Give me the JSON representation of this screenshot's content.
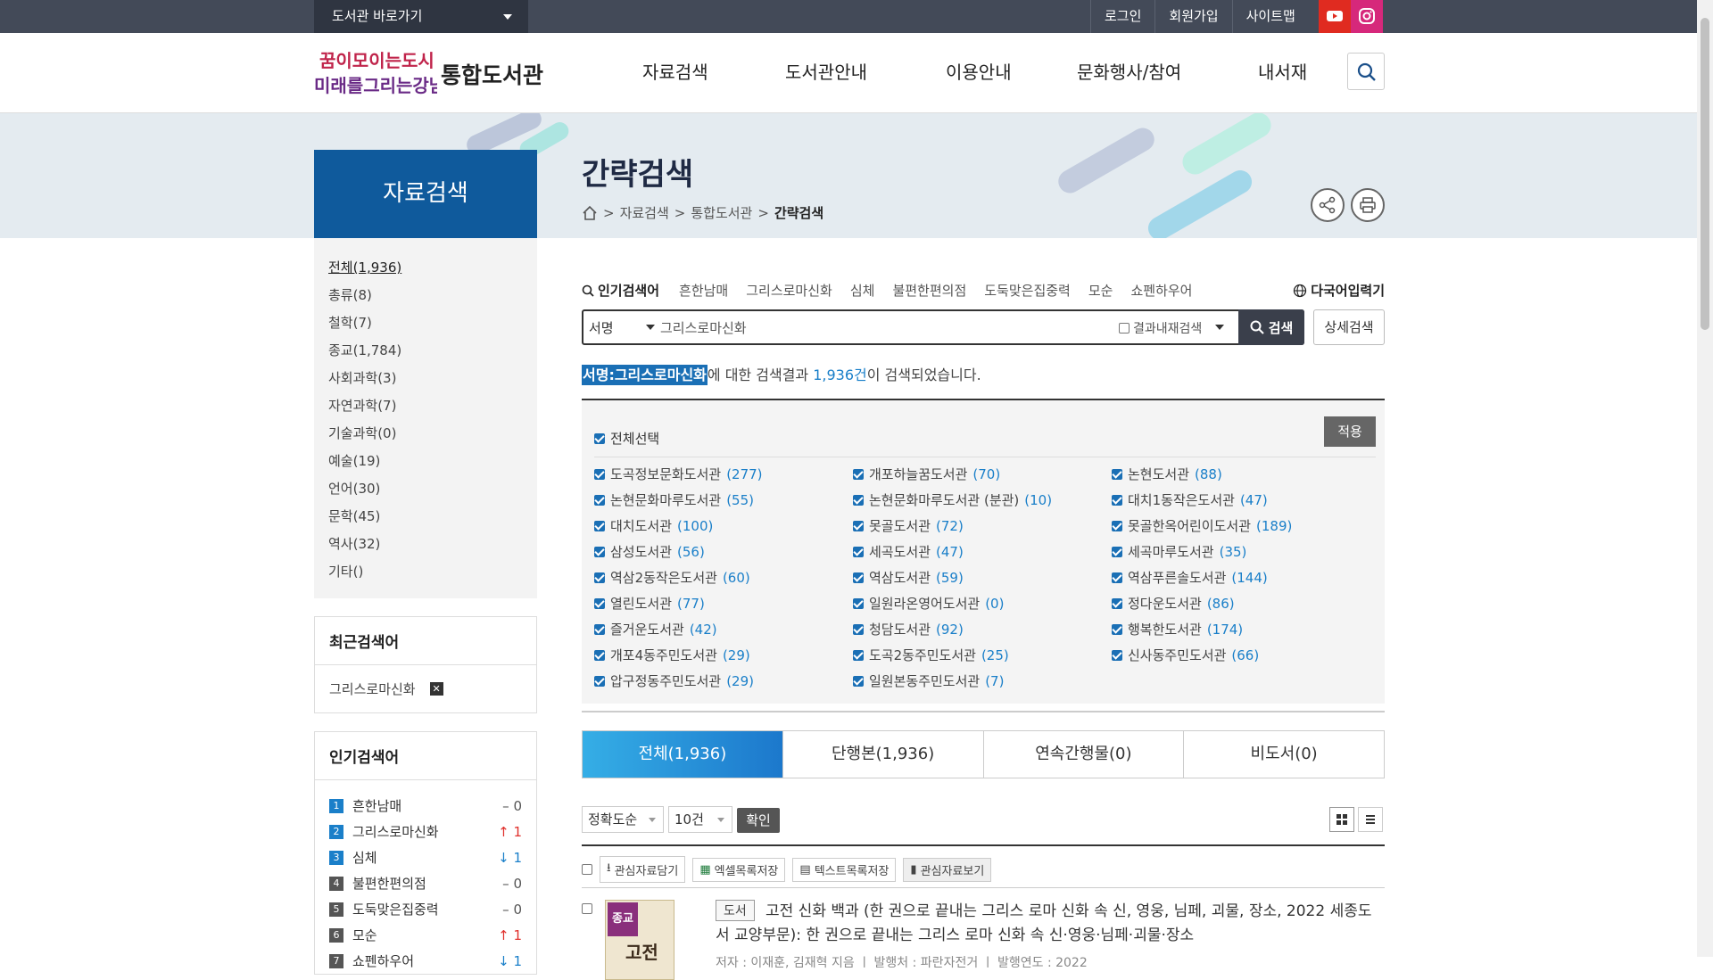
{
  "topbar": {
    "library_select": "도서관 바로가기",
    "links": [
      "로그인",
      "회원가입",
      "사이트맵"
    ]
  },
  "header": {
    "logo_art_text": "꿈이모이는도시 미래를그리는강남",
    "logo_text": "통합도서관",
    "gnb": [
      "자료검색",
      "도서관안내",
      "이용안내",
      "문화행사/참여",
      "내서재"
    ]
  },
  "page": {
    "section_title": "자료검색",
    "title": "간략검색",
    "breadcrumb": [
      "자료검색",
      "통합도서관",
      "간략검색"
    ],
    "breadcrumb_sep": ">"
  },
  "sidebar": {
    "categories": [
      "전체(1,936)",
      "총류(8)",
      "철학(7)",
      "종교(1,784)",
      "사회과학(3)",
      "자연과학(7)",
      "기술과학(0)",
      "예술(19)",
      "언어(30)",
      "문학(45)",
      "역사(32)",
      "기타()"
    ],
    "recent": {
      "title": "최근검색어",
      "items": [
        "그리스로마신화"
      ]
    },
    "popular": {
      "title": "인기검색어",
      "items": [
        {
          "rank": "1",
          "word": "흔한남매",
          "trend": "–",
          "change": "0"
        },
        {
          "rank": "2",
          "word": "그리스로마신화",
          "trend": "↑",
          "change": "1"
        },
        {
          "rank": "3",
          "word": "심체",
          "trend": "↓",
          "change": "1"
        },
        {
          "rank": "4",
          "word": "불편한편의점",
          "trend": "–",
          "change": "0"
        },
        {
          "rank": "5",
          "word": "도둑맞은집중력",
          "trend": "–",
          "change": "0"
        },
        {
          "rank": "6",
          "word": "모순",
          "trend": "↑",
          "change": "1"
        },
        {
          "rank": "7",
          "word": "쇼펜하우어",
          "trend": "↓",
          "change": "1"
        }
      ]
    }
  },
  "search": {
    "popular_label": "인기검색어",
    "popular_keywords": [
      "흔한남매",
      "그리스로마신화",
      "심체",
      "불편한편의점",
      "도둑맞은집중력",
      "모순",
      "쇼펜하우어"
    ],
    "multilang": "다국어입력기",
    "field": "서명",
    "query": "그리스로마신화",
    "within_results": "결과내재검색",
    "submit": "검색",
    "detail": "상세검색",
    "result_highlight": "서명:그리스로마신화",
    "result_mid": "에 대한 검색결과 ",
    "result_count": "1,936건",
    "result_tail": "이 검색되었습니다."
  },
  "libraries": {
    "select_all": "전체선택",
    "apply": "적용",
    "items": [
      {
        "name": "도곡정보문화도서관",
        "count": "(277)"
      },
      {
        "name": "개포하늘꿈도서관",
        "count": "(70)"
      },
      {
        "name": "논현도서관",
        "count": "(88)"
      },
      {
        "name": "논현문화마루도서관",
        "count": "(55)"
      },
      {
        "name": "논현문화마루도서관 (분관)",
        "count": "(10)"
      },
      {
        "name": "대치1동작은도서관",
        "count": "(47)"
      },
      {
        "name": "대치도서관",
        "count": "(100)"
      },
      {
        "name": "못골도서관",
        "count": "(72)"
      },
      {
        "name": "못골한옥어린이도서관",
        "count": "(189)"
      },
      {
        "name": "삼성도서관",
        "count": "(56)"
      },
      {
        "name": "세곡도서관",
        "count": "(47)"
      },
      {
        "name": "세곡마루도서관",
        "count": "(35)"
      },
      {
        "name": "역삼2동작은도서관",
        "count": "(60)"
      },
      {
        "name": "역삼도서관",
        "count": "(59)"
      },
      {
        "name": "역삼푸른솔도서관",
        "count": "(144)"
      },
      {
        "name": "열린도서관",
        "count": "(77)"
      },
      {
        "name": "일원라온영어도서관",
        "count": "(0)"
      },
      {
        "name": "정다운도서관",
        "count": "(86)"
      },
      {
        "name": "즐거운도서관",
        "count": "(42)"
      },
      {
        "name": "청담도서관",
        "count": "(92)"
      },
      {
        "name": "행복한도서관",
        "count": "(174)"
      },
      {
        "name": "개포4동주민도서관",
        "count": "(29)"
      },
      {
        "name": "도곡2동주민도서관",
        "count": "(25)"
      },
      {
        "name": "신사동주민도서관",
        "count": "(66)"
      },
      {
        "name": "압구정동주민도서관",
        "count": "(29)"
      },
      {
        "name": "일원본동주민도서관",
        "count": "(7)"
      }
    ]
  },
  "tabs": [
    "전체(1,936)",
    "단행본(1,936)",
    "연속간행물(0)",
    "비도서(0)"
  ],
  "controls": {
    "sort": "정확도순",
    "per_page": "10건",
    "confirm": "확인"
  },
  "actions": [
    "관심자료담기",
    "엑셀목록저장",
    "텍스트목록저장",
    "관심자료보기"
  ],
  "book": {
    "badge": "종교",
    "cover_title": "고전",
    "type": "도서",
    "title": "고전 신화 백과 (한 권으로 끝내는 그리스 로마 신화 속 신, 영웅, 님페, 괴물, 장소, 2022 세종도서 교양부문): 한 권으로 끝내는 그리스 로마 신화 속 신·영웅·님페·괴물·장소",
    "meta": "저자 : 이재훈, 김재혁 지음 ㅣ 발행처 : 파란자전거 ㅣ 발행연도 : 2022"
  },
  "colors": {
    "brand": "#0f5a9c",
    "accent": "#1a7fc9",
    "topbar": "#434a58"
  }
}
